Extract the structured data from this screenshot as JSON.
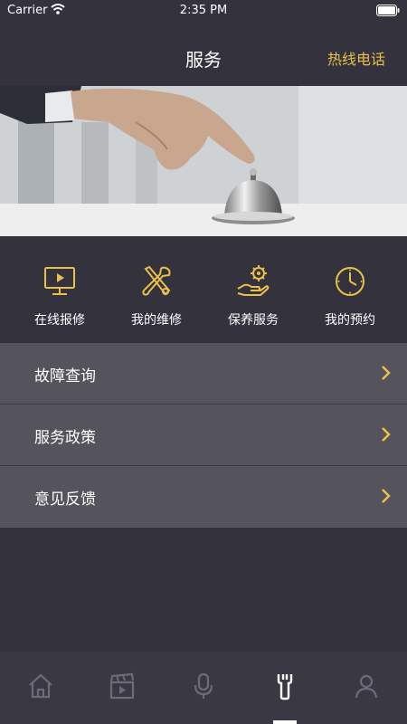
{
  "status_bar": {
    "carrier": "Carrier",
    "time": "2:35 PM"
  },
  "nav": {
    "title": "服务",
    "hotline": "热线电话"
  },
  "quick_services": [
    {
      "label": "在线报修",
      "icon": "monitor-repair-icon"
    },
    {
      "label": "我的维修",
      "icon": "tools-icon"
    },
    {
      "label": "保养服务",
      "icon": "hand-gear-icon"
    },
    {
      "label": "我的预约",
      "icon": "clock-icon"
    }
  ],
  "menu": [
    {
      "label": "故障查询"
    },
    {
      "label": "服务政策"
    },
    {
      "label": "意见反馈"
    }
  ],
  "tabs": [
    {
      "icon": "home-icon",
      "active": false
    },
    {
      "icon": "video-clapper-icon",
      "active": false
    },
    {
      "icon": "microphone-icon",
      "active": false
    },
    {
      "icon": "wrench-icon",
      "active": true
    },
    {
      "icon": "person-icon",
      "active": false
    }
  ],
  "colors": {
    "accent": "#e8c14b",
    "background": "#34323d",
    "row": "#55535c",
    "tab_inactive": "#6d6b77"
  }
}
